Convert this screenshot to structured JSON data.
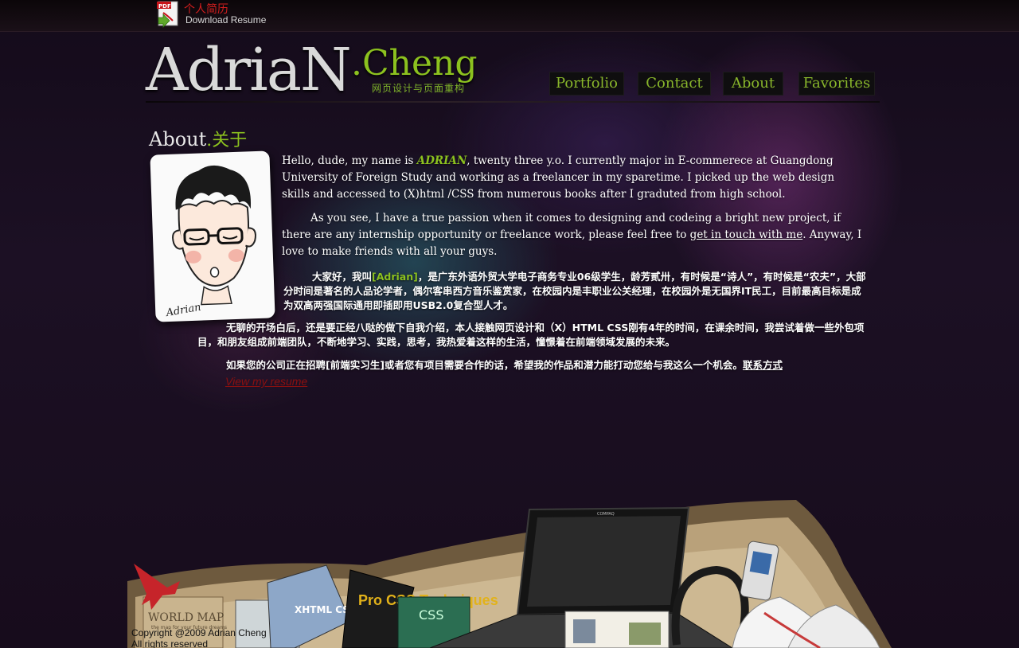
{
  "header": {
    "resume_cn": "个人简历",
    "resume_en": "Download Resume"
  },
  "logo": {
    "name": "AdriaN",
    "surname": ".Cheng",
    "tagline": "网页设计与页面重构"
  },
  "nav": {
    "items": [
      {
        "label": "Portfolio"
      },
      {
        "label": "Contact"
      },
      {
        "label": "About"
      },
      {
        "label": "Favorites"
      }
    ],
    "color": "#89b62b"
  },
  "about": {
    "heading_en": "About",
    "heading_dot": ".",
    "heading_cn": "关于",
    "avatar_signature": "Adrian",
    "p1_before": "Hello, dude, my name is ",
    "p1_name": "ADRIAN",
    "p1_after": ", twenty three y.o. I currently major in E-commerece at Guangdong University of Foreign Study and working as a freelancer in my sparetime. I picked up the web design skills and accessed to (X)html /CSS from numerous books after I graduted from high school.",
    "p2_before": "As you see, I have a true passion when it comes to designing and codeing a bright new project, if there are any internship opportunity or freelance work, please feel free to ",
    "p2_link": "get in touch with me",
    "p2_after": ". Anyway, I love to make friends with all your guys.",
    "cn1_before": "大家好，我叫",
    "cn1_name": "[Adrian]",
    "cn1_after": "，是广东外语外贸大学电子商务专业06级学生，龄芳贰卅，有时候是“诗人”，有时候是“农夫”，大部分时间是著名的人品论学者，偶尔客串西方音乐鉴赏家，在校园内是丰职业公关经理，在校园外是无国界IT民工，目前最高目标是成为双高两强国际通用即插即用USB2.0复合型人才。",
    "cn2": "无聊的开场白后，还是要正经八哒的做下自我介绍，本人接触网页设计和（X）HTML CSS刚有4年的时间，在课余时间，我尝试着做一些外包项目，和朋友组成前端团队，不断地学习、实践，思考，我热爱着这样的生活，憧憬着在前端领域发展的未来。",
    "cn3_before": "如果您的公司正在招聘[前端实习生]或者您有项目需要合作的话，希望我的作品和潜力能打动您给与我这么一个机会。",
    "cn3_link": "联系方式",
    "view_resume": "View my resume"
  },
  "footer": {
    "copyright_line1": "Copyright @2009 Adrian Cheng",
    "copyright_line2": "All rights reserved",
    "map_title": "WORLD MAP",
    "map_sub": "the map for your future dreams",
    "book1": "CSS",
    "book2": "Pro CSS Techniques",
    "book3": "XHTML CSS",
    "laptop_brand": "COMPAQ"
  },
  "colors": {
    "accent_green": "#8cc11f",
    "resume_red": "#d21e1e",
    "link_dark_red": "#8a1010"
  }
}
